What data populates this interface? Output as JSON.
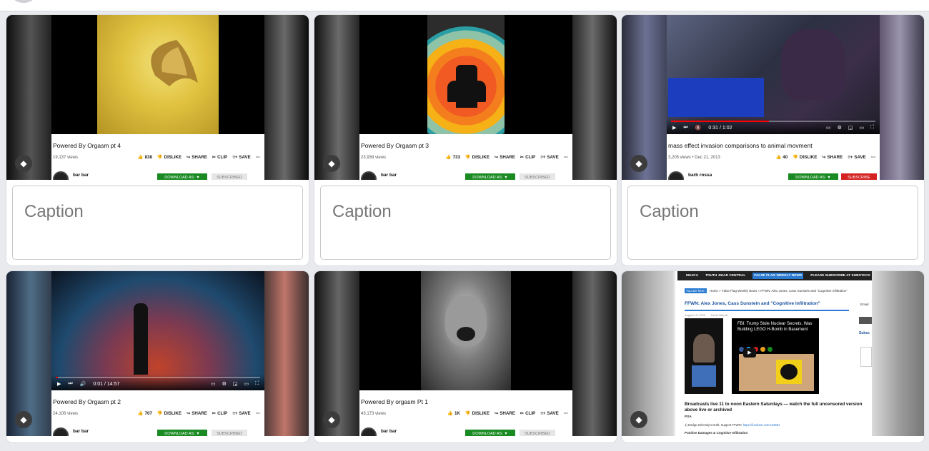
{
  "caption_placeholder": "Caption",
  "action_labels": {
    "dislike": "DISLIKE",
    "share": "SHARE",
    "clip": "CLIP",
    "save": "SAVE"
  },
  "download_label": "DOWNLOAD AS: ▼",
  "subscribed_label": "SUBSCRIBED",
  "subscribe_label": "SUBSCRIBE",
  "cards": [
    {
      "title": "Powered By Orgasm pt 4",
      "views": "19,137 views",
      "likes": "838",
      "channel": "bar bar",
      "show_controls": false
    },
    {
      "title": "Powered By Orgasm pt 3",
      "views": "23,939 views",
      "likes": "733",
      "channel": "bar bar",
      "show_controls": false
    },
    {
      "title": "mass effect invasion comparisons to animal movment",
      "views": "3,205 views • Dec 21, 2013",
      "likes": "40",
      "channel": "barb rossa",
      "time": "0:31 / 1:02",
      "show_controls": true
    },
    {
      "title": "Powered By Orgasm pt 2",
      "views": "24,106 views",
      "likes": "707",
      "channel": "bar bar",
      "time": "0:01 / 14:57",
      "show_controls": true
    },
    {
      "title": "Powered By orgasm Pt 1",
      "views": "43,173 views",
      "likes": "1K",
      "channel": "bar bar",
      "show_controls": false
    }
  ],
  "article": {
    "nav": [
      "MUJCA",
      "TRUTH JIHAD CENTRAL",
      "FALSE FLAG WEEKLY NEWS",
      "PLEASE SUBSCRIBE AT SUBSTACK"
    ],
    "you_are_here": "You are here:",
    "breadcrumb": "Home » False Flag Weekly News » FFWN: Alex Jones, Cass Sunstein and \"Cognitive Infiltration\"",
    "headline": "FFWN: Alex Jones, Cass Sunstein and \"Cognitive Infiltration\"",
    "date": "August 12, 2022",
    "author": "Kevin Barrett",
    "embed_title": "FBI: Trump Stole Nuclear Secrets, Was Building LEGO H-Bomb in Basement",
    "broadcast": "Broadcasts live 11 to noon Eastern Saturdays — watch the full uncensored version above live or archived",
    "psa": "PSA",
    "line1": "1) Dodge Zelensky's Draft, Support FFWN!",
    "line1_link": "https://fundrazr.com/c23961",
    "line2": "Punitive Damages & Cognitive Infiltration",
    "side_email": "Email",
    "side_subscribe": "Subsc"
  },
  "colors": {
    "download_green": "#1a8a22",
    "subscribe_red": "#d42222",
    "progress_red": "#ff0000"
  }
}
